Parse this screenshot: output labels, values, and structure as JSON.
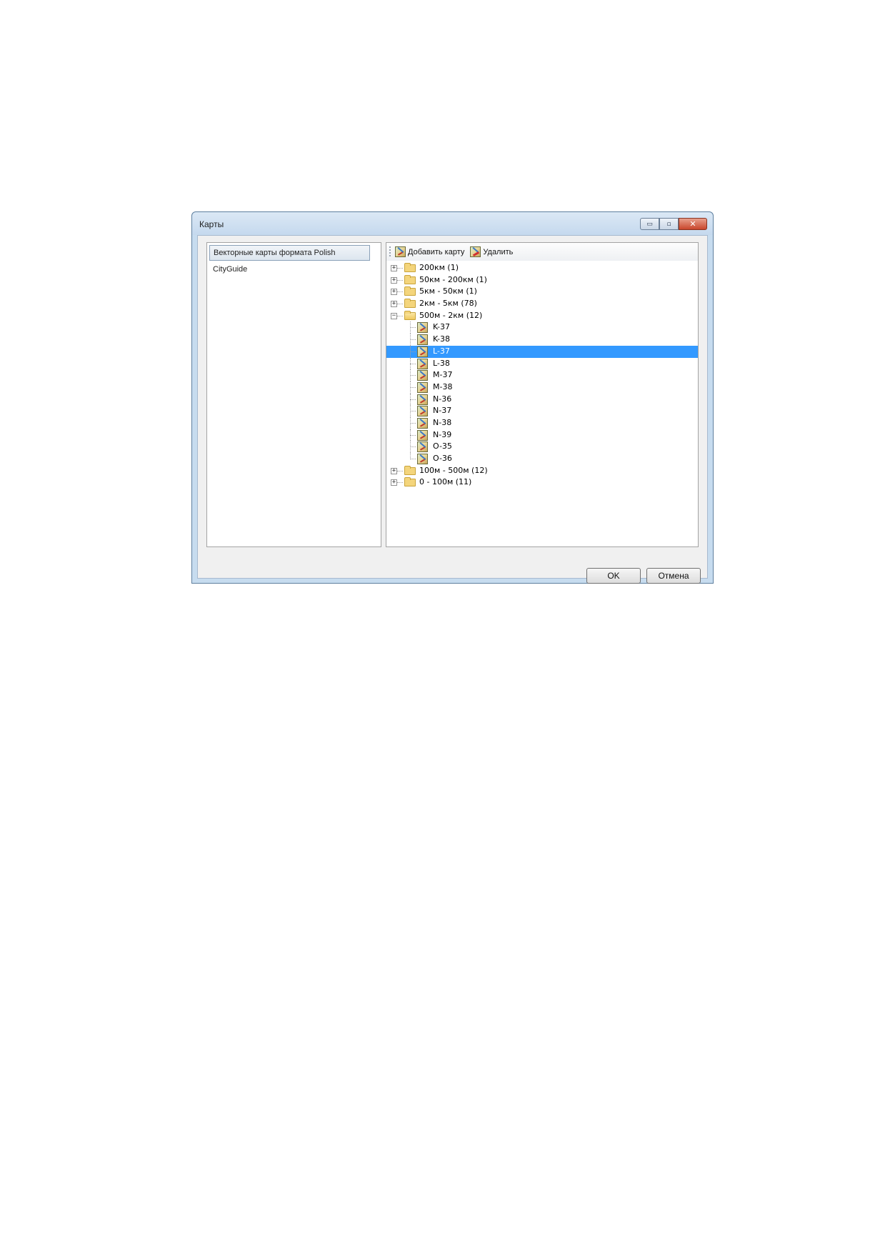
{
  "window": {
    "title": "Карты",
    "controls": {
      "minimize": "▭",
      "maximize": "▫",
      "close": "✕"
    }
  },
  "left_panel": {
    "items": [
      {
        "label": "Векторные карты формата Polish",
        "selected": true
      },
      {
        "label": "CityGuide",
        "selected": false
      }
    ]
  },
  "toolbar": {
    "add_label": "Добавить карту",
    "delete_label": "Удалить"
  },
  "tree": {
    "groups": [
      {
        "label": "200км (1)",
        "expanded": false
      },
      {
        "label": "50км - 200км (1)",
        "expanded": false
      },
      {
        "label": "5км - 50км (1)",
        "expanded": false
      },
      {
        "label": "2км - 5км (78)",
        "expanded": false
      },
      {
        "label": "500м - 2км (12)",
        "expanded": true,
        "children": [
          "K-37",
          "K-38",
          "L-37",
          "L-38",
          "M-37",
          "M-38",
          "N-36",
          "N-37",
          "N-38",
          "N-39",
          "O-35",
          "O-36"
        ],
        "selected_child": "L-37"
      },
      {
        "label": "100м - 500м (12)",
        "expanded": false
      },
      {
        "label": "0 - 100м (11)",
        "expanded": false
      }
    ]
  },
  "buttons": {
    "ok": "OK",
    "cancel": "Отмена"
  },
  "colors": {
    "selection": "#3399ff",
    "titlebar": "#c7dcef"
  }
}
